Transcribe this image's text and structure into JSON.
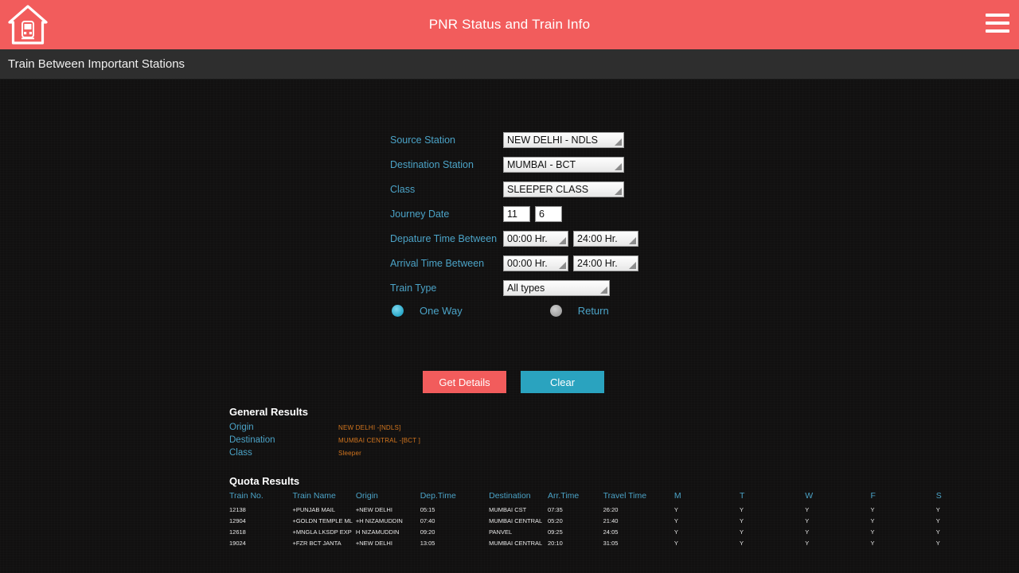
{
  "header": {
    "title": "PNR Status and Train Info",
    "logo_icon": "house-train-icon",
    "menu_icon": "hamburger-menu-icon",
    "accent_color": "#f25c5c"
  },
  "subheader": {
    "title": "Train Between Important Stations",
    "background_color": "#2e2e2e"
  },
  "form": {
    "source_station": {
      "label": "Source Station",
      "value": "NEW DELHI - NDLS"
    },
    "destination_station": {
      "label": "Destination Station",
      "value": "MUMBAI - BCT"
    },
    "class": {
      "label": "Class",
      "value": "SLEEPER CLASS"
    },
    "journey_date": {
      "label": "Journey Date",
      "day": "11",
      "month": "6"
    },
    "departure_time": {
      "label": "Depature Time Between",
      "from": "00:00 Hr.",
      "to": "24:00 Hr."
    },
    "arrival_time": {
      "label": "Arrival Time Between",
      "from": "00:00 Hr.",
      "to": "24:00 Hr."
    },
    "train_type": {
      "label": "Train Type",
      "value": "All types"
    },
    "trip_mode": {
      "one_way_label": "One Way",
      "return_label": "Return",
      "selected": "One Way"
    },
    "label_color": "#4ba3c7"
  },
  "actions": {
    "get_details_label": "Get Details",
    "clear_label": "Clear",
    "get_details_color": "#f25c5c",
    "clear_color": "#2aa3bf"
  },
  "general_results": {
    "heading": "General Results",
    "rows": [
      {
        "label": "Origin",
        "value": "NEW DELHI  -[NDLS]"
      },
      {
        "label": "Destination",
        "value": "MUMBAI CENTRAL  -[BCT ]"
      },
      {
        "label": "Class",
        "value": "Sleeper"
      }
    ],
    "value_color": "#d4761e"
  },
  "quota_results": {
    "heading": "Quota Results",
    "columns": [
      "Train No.",
      "Train Name",
      "Origin",
      "Dep.Time",
      "Destination",
      "Arr.Time",
      "Travel Time",
      "M",
      "T",
      "W",
      "F",
      "S"
    ],
    "rows": [
      {
        "train_no": "12138",
        "train_name": "+PUNJAB MAIL",
        "origin": "+NEW DELHI",
        "dep_time": "05:15",
        "destination": "MUMBAI CST",
        "arr_time": "07:35",
        "travel_time": "26:20",
        "m": "Y",
        "t": "Y",
        "w": "Y",
        "f": "Y",
        "s": "Y"
      },
      {
        "train_no": "12904",
        "train_name": "+GOLDN TEMPLE ML",
        "origin": "+H NIZAMUDDIN",
        "dep_time": "07:40",
        "destination": "MUMBAI CENTRAL",
        "arr_time": "05:20",
        "travel_time": "21:40",
        "m": "Y",
        "t": "Y",
        "w": "Y",
        "f": "Y",
        "s": "Y"
      },
      {
        "train_no": "12618",
        "train_name": "+MNGLA LKSDP EXP",
        "origin": "H NIZAMUDDIN",
        "dep_time": "09:20",
        "destination": "PANVEL",
        "arr_time": "09:25",
        "travel_time": "24:05",
        "m": "Y",
        "t": "Y",
        "w": "Y",
        "f": "Y",
        "s": "Y"
      },
      {
        "train_no": "19024",
        "train_name": "+FZR BCT JANTA",
        "origin": "+NEW DELHI",
        "dep_time": "13:05",
        "destination": "MUMBAI CENTRAL",
        "arr_time": "20:10",
        "travel_time": "31:05",
        "m": "Y",
        "t": "Y",
        "w": "Y",
        "f": "Y",
        "s": "Y"
      }
    ]
  }
}
